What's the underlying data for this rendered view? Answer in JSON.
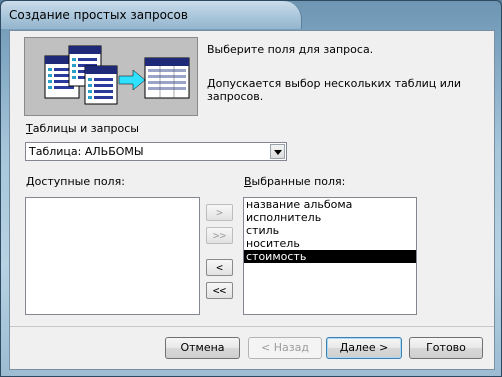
{
  "window": {
    "title": "Создание простых запросов"
  },
  "info": {
    "line1": "Выберите поля для запроса.",
    "line2": "Допускается выбор нескольких таблиц или запросов."
  },
  "tables": {
    "label_hotkey": "Т",
    "label_rest": "аблицы и запросы",
    "selected": "Таблица: АЛЬБОМЫ"
  },
  "available": {
    "label_hotkey": "Д",
    "label_rest": "оступные поля:",
    "items": []
  },
  "selected_fields": {
    "label_hotkey": "В",
    "label_rest": "ыбранные поля:",
    "items": [
      "название альбома",
      "исполнитель",
      "стиль",
      "носитель",
      "стоимость"
    ],
    "highlighted_index": 4
  },
  "move_buttons": {
    "add": ">",
    "add_all": ">>",
    "remove": "<",
    "remove_all": "<<"
  },
  "footer": {
    "cancel": "Отмена",
    "back": "< Назад",
    "next": "Далее >",
    "done": "Готово"
  }
}
